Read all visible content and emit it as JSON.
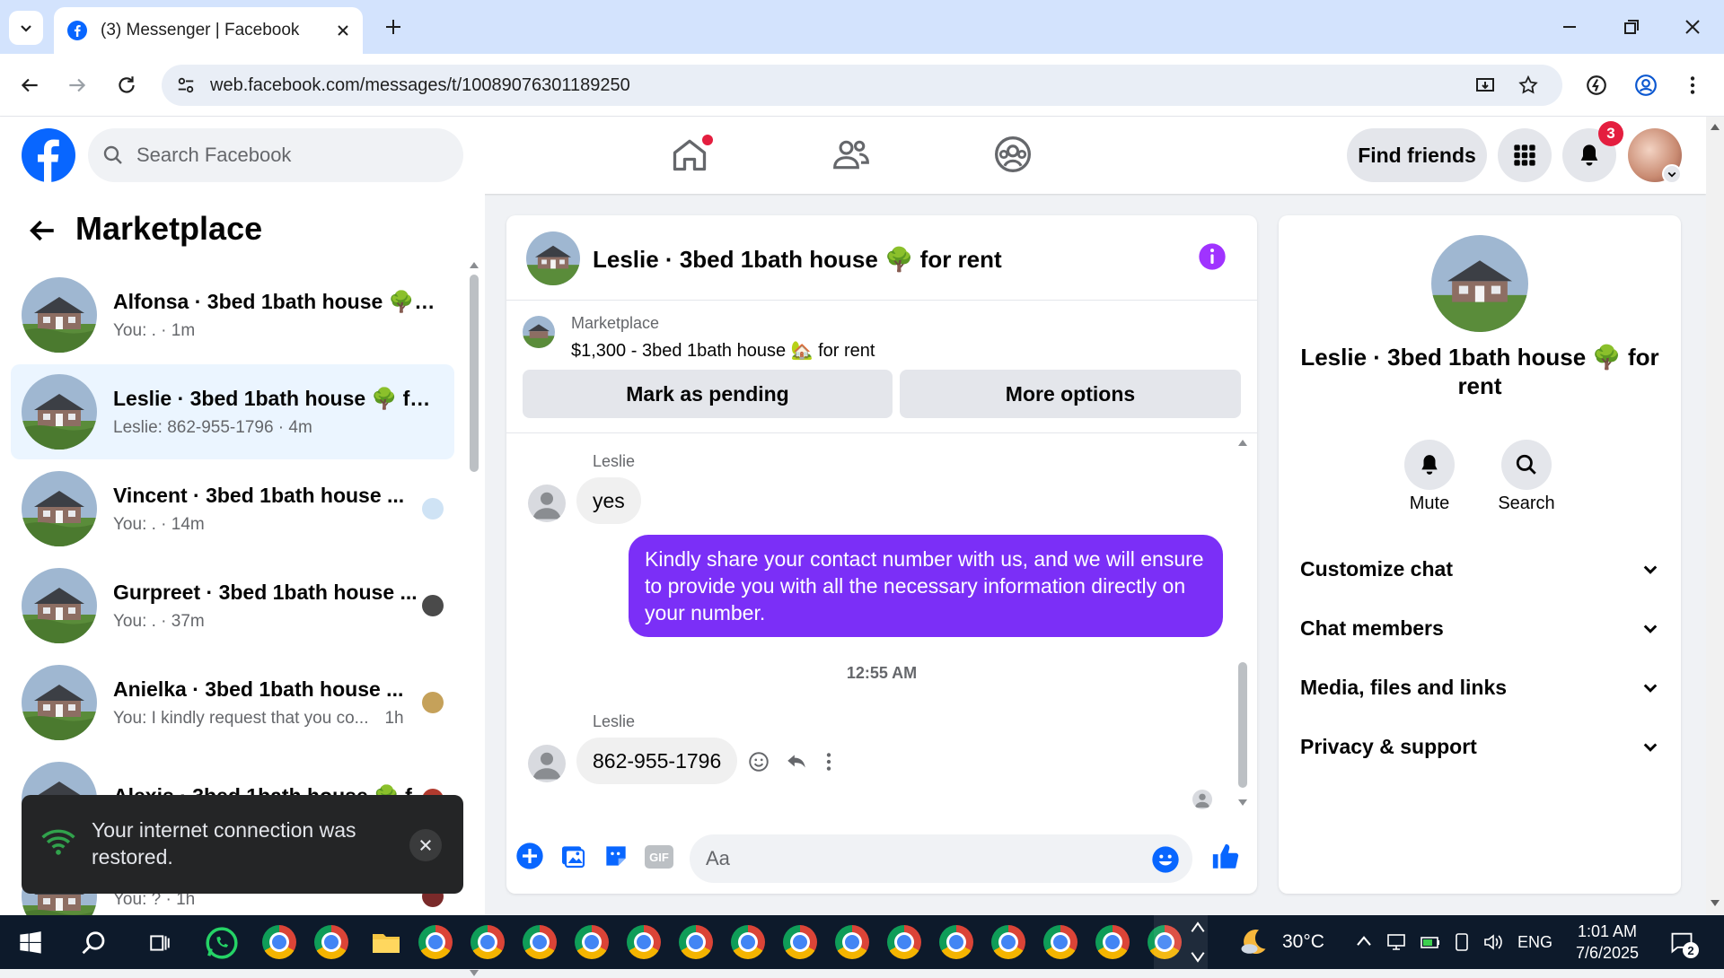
{
  "browser": {
    "tab_title": "(3) Messenger | Facebook",
    "url": "web.facebook.com/messages/t/10089076301189250"
  },
  "fb": {
    "search_placeholder": "Search Facebook",
    "find_friends": "Find friends",
    "notifications_count": "3",
    "brand_color": "#0866ff"
  },
  "left": {
    "title": "Marketplace",
    "conversations": [
      {
        "name": "Alfonsa · 3bed 1bath house 🌳 f...",
        "sub": "You: . · 1m"
      },
      {
        "name": "Leslie · 3bed 1bath house 🌳 for ...",
        "sub": "Leslie: 862-955-1796 · 4m"
      },
      {
        "name": "Vincent · 3bed 1bath house ...",
        "sub": "You: . · 14m"
      },
      {
        "name": "Gurpreet · 3bed 1bath house ...",
        "sub": "You: . · 37m"
      },
      {
        "name": "Anielka · 3bed 1bath house ...",
        "sub": "You: I kindly request that you co...",
        "time": "1h"
      },
      {
        "name": "Alexis · 3bed 1bath house 🌳 f...",
        "sub": ""
      },
      {
        "name": "",
        "sub": "You: ? · 1h"
      }
    ]
  },
  "chat": {
    "title": "Leslie · 3bed 1bath house 🌳 for rent",
    "listing_label": "Marketplace",
    "listing_text": "$1,300 - 3bed 1bath house 🏡 for rent",
    "mark_pending": "Mark as pending",
    "more_options": "More options",
    "messages": [
      {
        "sender": "Leslie",
        "text": "yes"
      },
      {
        "sender": "me",
        "text": "Kindly share your contact number with us, and we will ensure to provide you with all the necessary information directly on your number."
      },
      {
        "timestamp": "12:55 AM"
      },
      {
        "sender": "Leslie",
        "text": "862-955-1796"
      }
    ],
    "input_placeholder": "Aa",
    "outgoing_color": "#7b2ff7"
  },
  "right": {
    "name": "Leslie · 3bed 1bath house 🌳 for rent",
    "mute": "Mute",
    "search": "Search",
    "sections": [
      "Customize chat",
      "Chat members",
      "Media, files and links",
      "Privacy & support"
    ]
  },
  "toast": {
    "text": "Your internet connection was restored."
  },
  "taskbar": {
    "weather": "30°C",
    "lang": "ENG",
    "time": "1:01 AM",
    "date": "7/6/2025",
    "notif": "2"
  }
}
